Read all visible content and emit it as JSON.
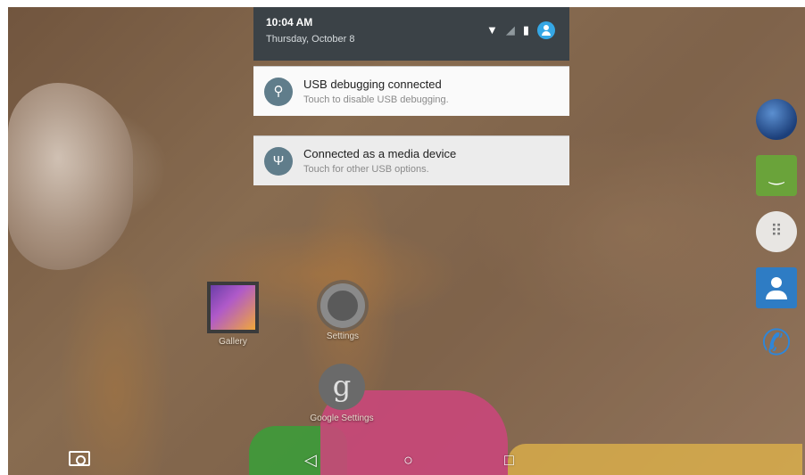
{
  "status": {
    "time": "10:04 AM",
    "date": "Thursday, October 8",
    "icons": [
      "wifi-icon",
      "signal-icon",
      "battery-icon",
      "user-icon"
    ]
  },
  "notifications": [
    {
      "icon": "usb-debug-icon",
      "title": "USB debugging connected",
      "subtitle": "Touch to disable USB debugging."
    },
    {
      "icon": "usb-icon",
      "title": "Connected as a media device",
      "subtitle": "Touch for other USB options."
    }
  ],
  "desktop": {
    "gallery_label": "Gallery",
    "settings_label": "Settings",
    "google_settings_label": "Google Settings"
  },
  "dock": [
    "browser-icon",
    "messenger-icon",
    "apps-icon",
    "contacts-icon",
    "phone-icon"
  ],
  "navbar": [
    "screenshot-icon",
    "back-icon",
    "home-icon",
    "recents-icon"
  ],
  "colors": {
    "header_bg": "#3b4247",
    "notification_icon_bg": "#607d8b",
    "user_avatar": "#35a7e5"
  }
}
